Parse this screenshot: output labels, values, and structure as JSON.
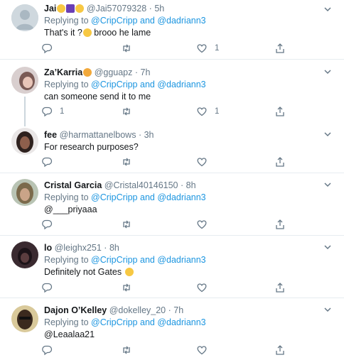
{
  "tweets": [
    {
      "name": "Jai",
      "handle": "@Jai57079328",
      "time": "5h",
      "replying_prefix": "Replying to",
      "mention1": "@CripCripp",
      "and": "and",
      "mention2": "@dadriann3",
      "text": "That's it ?",
      "text_after": " brooo he lame",
      "reply_count": "",
      "like_count": "1"
    },
    {
      "name": "Za’Karria",
      "handle": "@gguapz",
      "time": "7h",
      "replying_prefix": "Replying to",
      "mention1": "@CripCripp",
      "and": "and",
      "mention2": "@dadriann3",
      "text": "can someone send it to me",
      "reply_count": "1",
      "like_count": "1"
    },
    {
      "name": "fee",
      "handle": "@harmattanelbows",
      "time": "3h",
      "text": "For research purposes?",
      "reply_count": "",
      "like_count": ""
    },
    {
      "name": "Cristal Garcia",
      "handle": "@Cristal40146150",
      "time": "8h",
      "replying_prefix": "Replying to",
      "mention1": "@CripCripp",
      "and": "and",
      "mention2": "@dadriann3",
      "text": "@___priyaaa",
      "reply_count": "",
      "like_count": ""
    },
    {
      "name": "lo",
      "handle": "@leighx251",
      "time": "8h",
      "replying_prefix": "Replying to",
      "mention1": "@CripCripp",
      "and": "and",
      "mention2": "@dadriann3",
      "text": "Definitely not Gates",
      "reply_count": "",
      "like_count": ""
    },
    {
      "name": "Dajon O’Kelley",
      "handle": "@dokelley_20",
      "time": "7h",
      "replying_prefix": "Replying to",
      "mention1": "@CripCripp",
      "and": "and",
      "mention2": "@dadriann3",
      "text": "@Leaalaa21",
      "reply_count": "",
      "like_count": ""
    }
  ],
  "separator": "·",
  "colors": {
    "link": "#1b95e0",
    "muted": "#657786",
    "divider": "#e6ecf0",
    "thread": "#ccd6dd"
  },
  "icons": [
    "chevron-down-icon",
    "reply-icon",
    "retweet-icon",
    "like-icon",
    "share-icon",
    "emoji-icon"
  ]
}
